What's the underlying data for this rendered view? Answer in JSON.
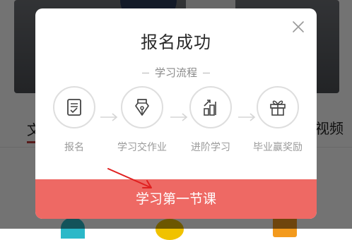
{
  "modal": {
    "title": "报名成功",
    "subtitle": "学习流程",
    "steps": [
      {
        "label": "报名",
        "icon": "clipboard-icon"
      },
      {
        "label": "学习交作业",
        "icon": "pen-nib-icon"
      },
      {
        "label": "进阶学习",
        "icon": "level-up-bars-icon"
      },
      {
        "label": "毕业赢奖励",
        "icon": "gift-icon"
      }
    ],
    "cta_label": "学习第一节课",
    "close_icon": "close-icon"
  },
  "background": {
    "tab_left": "文",
    "tab_right": "视频"
  },
  "colors": {
    "cta": "#ee6964",
    "overlay": "rgba(0,0,0,0.55)",
    "annotation_arrow": "#e02020",
    "tab_underline": "#c23c3c"
  }
}
